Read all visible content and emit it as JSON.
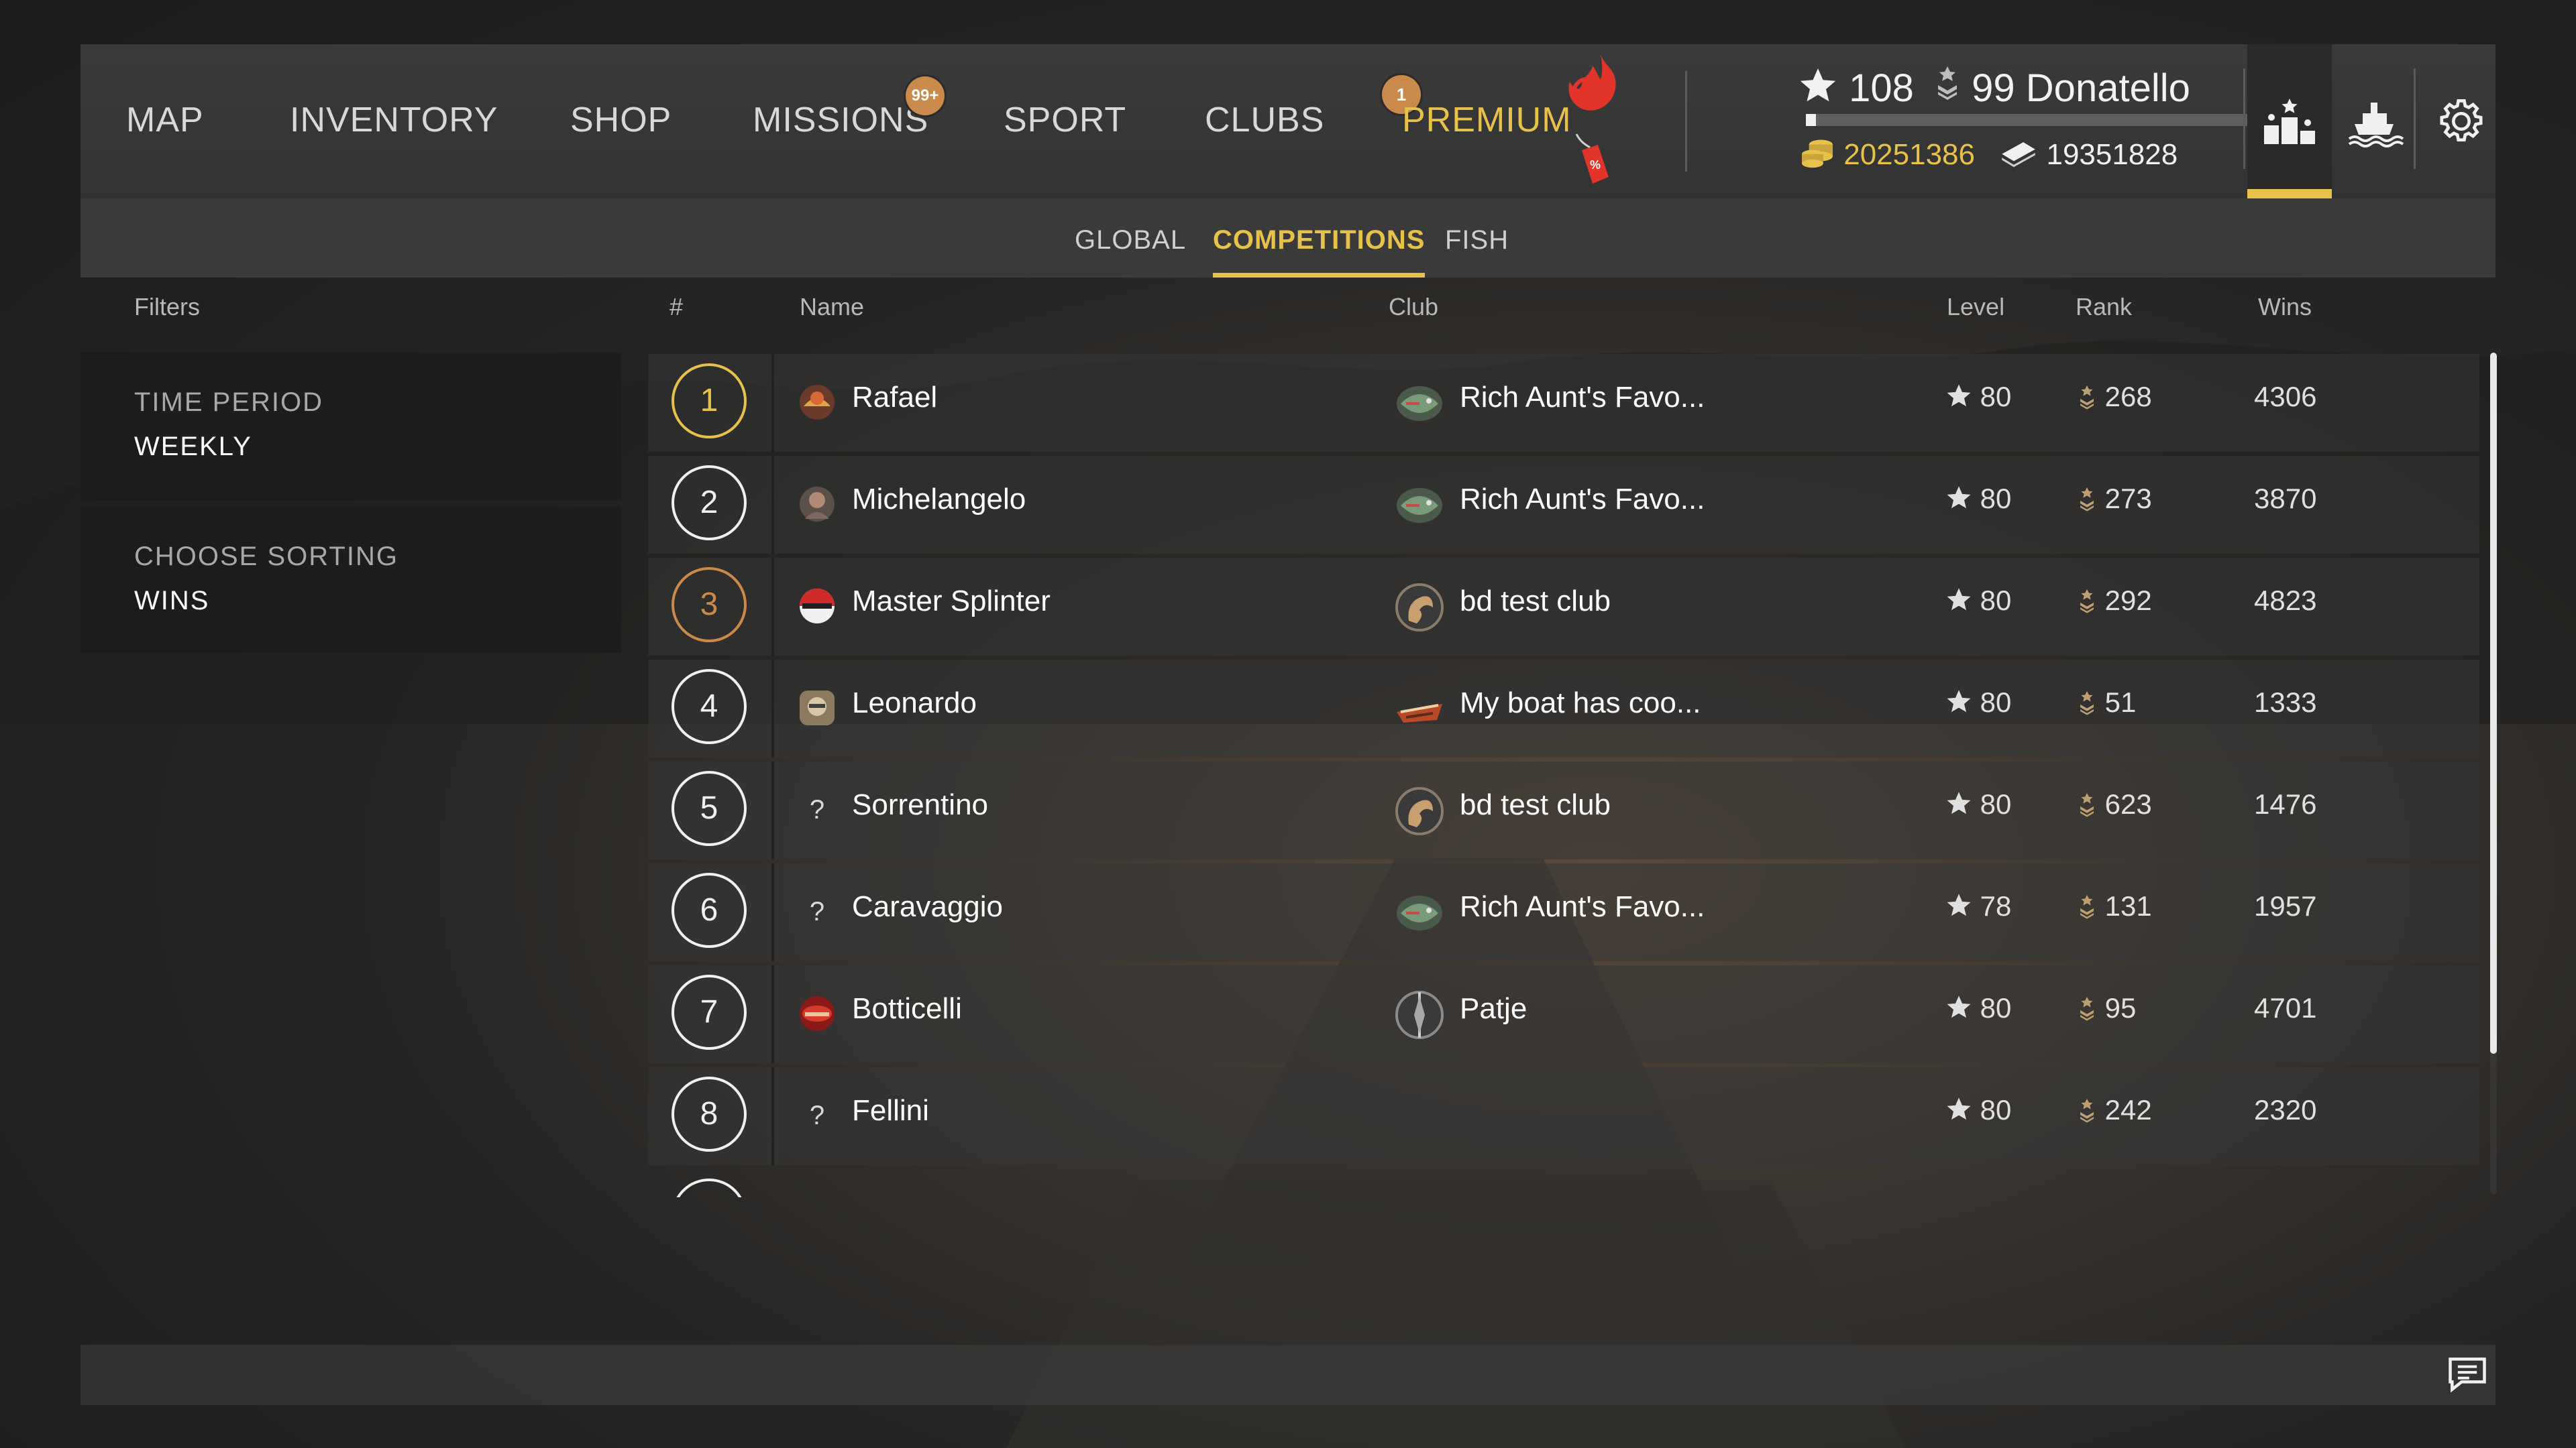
{
  "nav": {
    "items": [
      {
        "label": "MAP"
      },
      {
        "label": "INVENTORY"
      },
      {
        "label": "SHOP"
      },
      {
        "label": "MISSIONS",
        "badge": "99+"
      },
      {
        "label": "SPORT"
      },
      {
        "label": "CLUBS",
        "badge": "1"
      },
      {
        "label": "PREMIUM"
      }
    ],
    "premium_tag": "%"
  },
  "profile": {
    "level": "108",
    "rank": "99",
    "name": "Donatello",
    "xp_progress": 0.02,
    "gold": "20251386",
    "silver": "19351828"
  },
  "toolbar_icons": [
    "leaderboard-icon",
    "ship-icon",
    "gear-icon"
  ],
  "tabs": {
    "items": [
      {
        "label": "GLOBAL"
      },
      {
        "label": "COMPETITIONS",
        "active": true
      },
      {
        "label": "FISH"
      }
    ]
  },
  "filters": {
    "heading": "Filters",
    "period_label": "TIME PERIOD",
    "period_value": "WEEKLY",
    "sorting_label": "CHOOSE SORTING",
    "sorting_value": "WINS"
  },
  "table": {
    "headers": {
      "num": "#",
      "name": "Name",
      "club": "Club",
      "level": "Level",
      "rank": "Rank",
      "wins": "Wins"
    },
    "rows": [
      {
        "pos": "1",
        "name": "Rafael",
        "club": "Rich Aunt's Favo...",
        "level": "80",
        "rank": "268",
        "wins": "4306"
      },
      {
        "pos": "2",
        "name": "Michelangelo",
        "club": "Rich Aunt's Favo...",
        "level": "80",
        "rank": "273",
        "wins": "3870"
      },
      {
        "pos": "3",
        "name": "Master Splinter",
        "club": "bd test club",
        "level": "80",
        "rank": "292",
        "wins": "4823"
      },
      {
        "pos": "4",
        "name": "Leonardo",
        "club": "My boat has coo...",
        "level": "80",
        "rank": "51",
        "wins": "1333"
      },
      {
        "pos": "5",
        "name": "Sorrentino",
        "avatar": "?",
        "club": "bd test club",
        "level": "80",
        "rank": "623",
        "wins": "1476"
      },
      {
        "pos": "6",
        "name": "Caravaggio",
        "avatar": "?",
        "club": "Rich Aunt's Favo...",
        "level": "78",
        "rank": "131",
        "wins": "1957"
      },
      {
        "pos": "7",
        "name": "Botticelli",
        "club": "Patje",
        "level": "80",
        "rank": "95",
        "wins": "4701"
      },
      {
        "pos": "8",
        "name": "Fellini",
        "avatar": "?",
        "club": "",
        "level": "80",
        "rank": "242",
        "wins": "2320"
      }
    ]
  },
  "colors": {
    "accent": "#e6c24a",
    "badge": "#c98a4b",
    "bronze": "#c98a4b"
  }
}
